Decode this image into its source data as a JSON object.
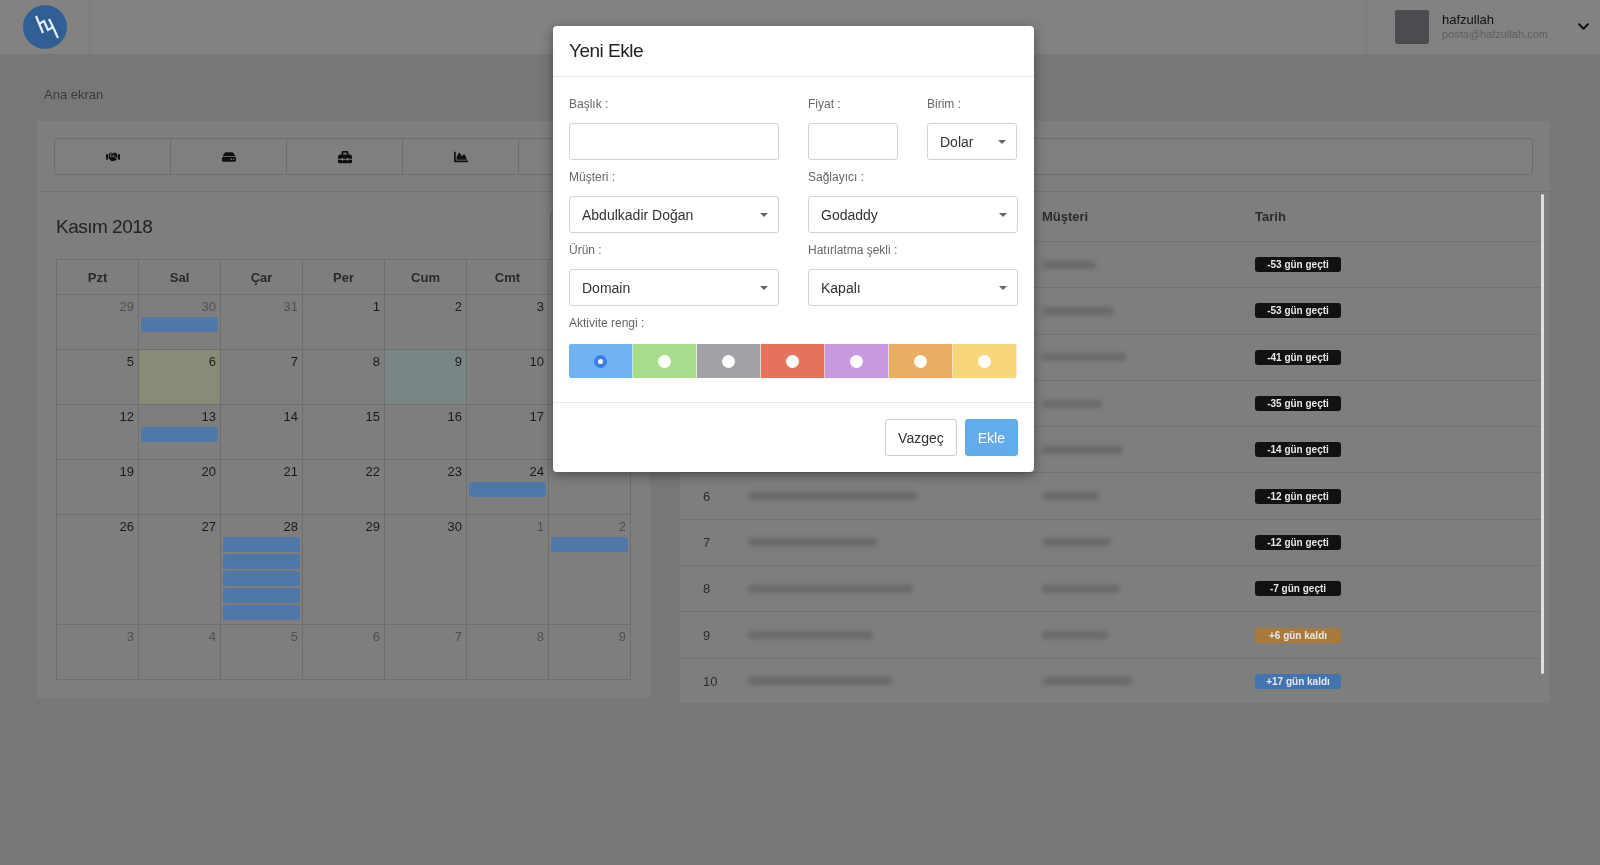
{
  "header": {
    "user": {
      "name": "hafzullah",
      "email": "posta@hafzullah.com"
    }
  },
  "breadcrumb": "Ana ekran",
  "calendar": {
    "title": "Kasım 2018",
    "weekdays": [
      "Pzt",
      "Sal",
      "Çar",
      "Per",
      "Cum",
      "Cmt"
    ],
    "weeks": [
      [
        {
          "day": "29",
          "muted": true
        },
        {
          "day": "30",
          "muted": true,
          "events": [
            {
              "kind": "bar"
            }
          ]
        },
        {
          "day": "31",
          "muted": true
        },
        {
          "day": "1",
          "muted": false
        },
        {
          "day": "2",
          "muted": false
        },
        {
          "day": "3",
          "muted": false
        }
      ],
      [
        {
          "day": "5",
          "muted": false
        },
        {
          "day": "6",
          "muted": false,
          "color": "#8a8a78"
        },
        {
          "day": "7",
          "muted": false
        },
        {
          "day": "8",
          "muted": false
        },
        {
          "day": "9",
          "muted": false,
          "color": "#7a8686"
        },
        {
          "day": "10",
          "muted": false
        }
      ],
      [
        {
          "day": "12",
          "muted": false
        },
        {
          "day": "13",
          "muted": false,
          "events": [
            {
              "kind": "bar"
            }
          ]
        },
        {
          "day": "14",
          "muted": false
        },
        {
          "day": "15",
          "muted": false
        },
        {
          "day": "16",
          "muted": false
        },
        {
          "day": "17",
          "muted": false
        }
      ],
      [
        {
          "day": "19",
          "muted": false
        },
        {
          "day": "20",
          "muted": false
        },
        {
          "day": "21",
          "muted": false
        },
        {
          "day": "22",
          "muted": false
        },
        {
          "day": "23",
          "muted": false
        },
        {
          "day": "24",
          "muted": false,
          "events": [
            {
              "kind": "bar"
            }
          ]
        }
      ],
      [
        {
          "day": "26",
          "muted": false
        },
        {
          "day": "27",
          "muted": false
        },
        {
          "day": "28",
          "muted": false,
          "events": [
            {
              "kind": "bar"
            },
            {
              "kind": "bar"
            },
            {
              "kind": "bar"
            },
            {
              "kind": "bar"
            },
            {
              "kind": "bar"
            }
          ]
        },
        {
          "day": "29",
          "muted": false
        },
        {
          "day": "30",
          "muted": false
        },
        {
          "day": "1",
          "muted": true
        },
        {
          "day": "2",
          "muted": true,
          "events": [
            {
              "kind": "bar"
            }
          ]
        }
      ],
      [
        {
          "day": "3",
          "muted": true
        },
        {
          "day": "4",
          "muted": true
        },
        {
          "day": "5",
          "muted": true
        },
        {
          "day": "6",
          "muted": true
        },
        {
          "day": "7",
          "muted": true
        },
        {
          "day": "8",
          "muted": true
        },
        {
          "day": "9",
          "muted": true
        }
      ]
    ]
  },
  "table": {
    "columns": [
      "Müşteri",
      "Tarih"
    ],
    "rows": [
      {
        "date": {
          "text": "-53 gün geçti",
          "color": "#111111"
        }
      },
      {
        "date": {
          "text": "-53 gün geçti",
          "color": "#111111"
        }
      },
      {
        "date": {
          "text": "-41 gün geçti",
          "color": "#111111"
        }
      },
      {
        "date": {
          "text": "-35 gün geçti",
          "color": "#111111"
        }
      },
      {
        "date": {
          "text": "-14 gün geçti",
          "color": "#111111"
        }
      },
      {
        "number": "6",
        "date": {
          "text": "-12 gün geçti",
          "color": "#111111"
        }
      },
      {
        "number": "7",
        "date": {
          "text": "-12 gün geçti",
          "color": "#111111"
        }
      },
      {
        "number": "8",
        "date": {
          "text": "-7 gün geçti",
          "color": "#111111"
        }
      },
      {
        "number": "9",
        "date": {
          "text": "+6 gün kaldı",
          "color": "#a87a3c"
        }
      },
      {
        "number": "10",
        "date": {
          "text": "+17 gün kaldı",
          "color": "#4474b0"
        }
      }
    ]
  },
  "modal": {
    "title": "Yeni Ekle",
    "rows": [
      [
        {
          "label": "Başlık :",
          "kind": "text"
        },
        {
          "label": "Fiyat :",
          "kind": "text"
        },
        {
          "label": "Birim :",
          "kind": "select",
          "value": "Dolar"
        }
      ],
      [
        {
          "label": "Müşteri :",
          "kind": "select",
          "value": "Abdulkadir Doğan"
        },
        {
          "label": "Sağlayıcı :",
          "kind": "select",
          "value": "Godaddy"
        }
      ],
      [
        {
          "label": "Ürün :",
          "kind": "select",
          "value": "Domain"
        },
        {
          "label": "Hatırlatma şekli :",
          "kind": "select",
          "value": "Kapalı"
        }
      ]
    ],
    "color_picker": {
      "label": "Aktivite rengi :",
      "options": [
        {
          "color": "#6fb3f2",
          "selected": true
        },
        {
          "color": "#a6dc8a",
          "selected": false
        },
        {
          "color": "#a2a2a6",
          "selected": false
        },
        {
          "color": "#e5735c",
          "selected": false
        },
        {
          "color": "#c79ae0",
          "selected": false
        },
        {
          "color": "#eaae62",
          "selected": false
        },
        {
          "color": "#f8d77a",
          "selected": false
        }
      ]
    },
    "buttons": [
      {
        "label": "Vazgeç",
        "kind": "secondary"
      },
      {
        "label": "Ekle",
        "kind": "primary"
      }
    ]
  }
}
